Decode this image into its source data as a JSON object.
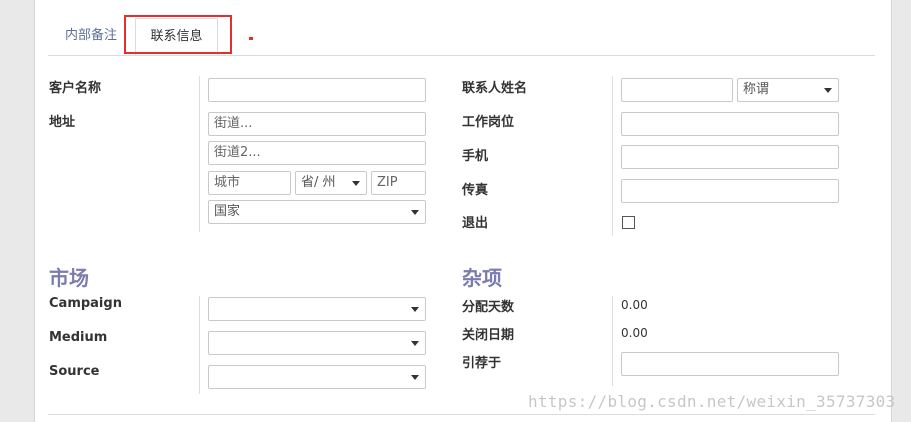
{
  "tabs": {
    "notes": "内部备注",
    "contact": "联系信息"
  },
  "left": {
    "customer_name_label": "客户名称",
    "address_label": "地址",
    "street_placeholder": "街道...",
    "street2_placeholder": "街道2...",
    "city_placeholder": "城市",
    "state_value": "省/ 州",
    "zip_placeholder": "ZIP",
    "country_value": "国家"
  },
  "right": {
    "contact_name_label": "联系人姓名",
    "title_value": "称谓",
    "job_label": "工作岗位",
    "mobile_label": "手机",
    "fax_label": "传真",
    "optout_label": "退出"
  },
  "marketing": {
    "title": "市场",
    "campaign_label": "Campaign",
    "medium_label": "Medium",
    "source_label": "Source"
  },
  "misc": {
    "title": "杂项",
    "assign_days_label": "分配天数",
    "assign_days_value": "0.00",
    "close_days_label": "关闭日期",
    "close_days_value": "0.00",
    "referred_label": "引荐于"
  },
  "watermark": "https://blog.csdn.net/weixin_35737303",
  "colors": {
    "section": "#7c7bad",
    "highlight": "#e0312a",
    "tab_link": "#5f6f9a"
  }
}
